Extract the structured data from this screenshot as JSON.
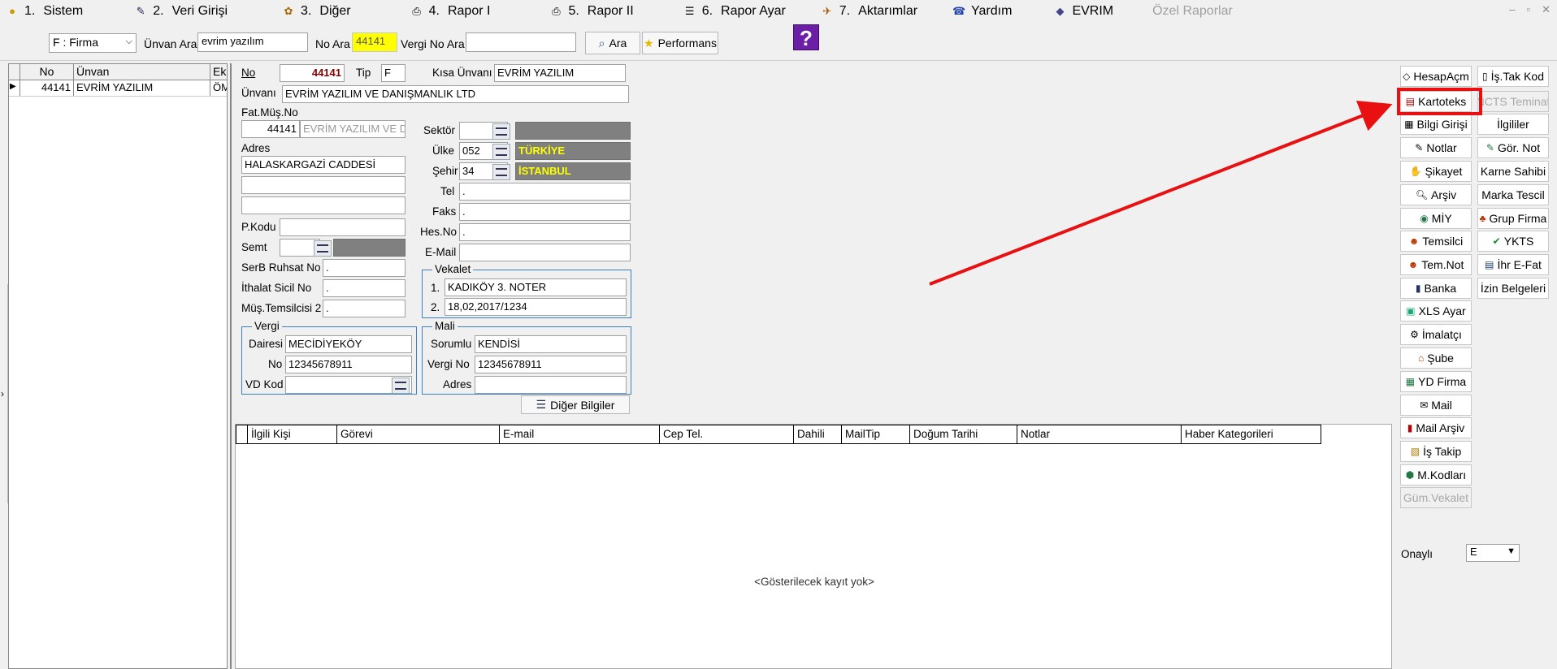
{
  "menu": [
    {
      "icon": "gold-coins-icon",
      "num": "1.",
      "label": "Sistem"
    },
    {
      "icon": "data-entry-icon",
      "num": "2.",
      "label": "Veri Girişi"
    },
    {
      "icon": "other-icon",
      "num": "3.",
      "label": "Diğer"
    },
    {
      "icon": "printer-icon",
      "num": "4.",
      "label": "Rapor I"
    },
    {
      "icon": "printer-icon",
      "num": "5.",
      "label": "Rapor II"
    },
    {
      "icon": "report-settings-icon",
      "num": "6.",
      "label": "Rapor Ayar"
    },
    {
      "icon": "transfer-icon",
      "num": "7.",
      "label": "Aktarımlar"
    },
    {
      "icon": "help-icon",
      "num": "",
      "label": "Yardım"
    },
    {
      "icon": "evrim-icon",
      "num": "",
      "label": "EVRIM"
    },
    {
      "icon": "",
      "num": "",
      "label": "Özel Raporlar"
    }
  ],
  "window_controls": [
    "–",
    "▫",
    "✕"
  ],
  "search": {
    "type_value": "F : Firma",
    "unvan_label": "Ünvan Ara",
    "unvan_value": "evrim yazılım",
    "no_label": "No Ara",
    "no_value": "44141",
    "vergi_label": "Vergi No Ara",
    "vergi_value": "",
    "ara_button": "Ara",
    "performans_button": "Performans",
    "help_glyph": "?"
  },
  "left_grid": {
    "columns": [
      "No",
      "Ünvan",
      "Ek"
    ],
    "rows": [
      {
        "no": "44141",
        "unvan": "EVRİM YAZILIM",
        "ek": "ÖM"
      }
    ]
  },
  "form": {
    "no_label": "No",
    "no_value": "44141",
    "tip_label": "Tip",
    "tip_value": "F",
    "kisa_label": "Kısa Ünvanı",
    "kisa_value": "EVRİM YAZILIM",
    "unvan_label": "Ünvanı",
    "unvan_value": "EVRİM YAZILIM VE DANIŞMANLIK LTD",
    "fatmus_label": "Fat.Müş.No",
    "fatmus_no": "44141",
    "fatmus_name": "EVRİM YAZILIM VE D",
    "adres_label": "Adres",
    "adres1": "HALASKARGAZİ CADDESİ",
    "adres2": "",
    "adres3": "",
    "pkodu_label": "P.Kodu",
    "pkodu_value": "",
    "semt_label": "Semt",
    "semt_value": "",
    "serb_label": "SerB Ruhsat No",
    "serb_value": ".",
    "ithalat_label": "İthalat Sicil No",
    "ithalat_value": ".",
    "mustem_label": "Müş.Temsilcisi 2",
    "mustem_value": ".",
    "sektor_label": "Sektör",
    "sektor_value": "",
    "sektor_name": "",
    "ulke_label": "Ülke",
    "ulke_value": "052",
    "ulke_name": "TÜRKİYE",
    "sehir_label": "Şehir",
    "sehir_value": "34",
    "sehir_name": "İSTANBUL",
    "tel_label": "Tel",
    "tel_value": ".",
    "faks_label": "Faks",
    "faks_value": ".",
    "hesno_label": "Hes.No",
    "hesno_value": ".",
    "email_label": "E-Mail",
    "email_value": "",
    "vekalet_title": "Vekalet",
    "vekalet_1_num": "1.",
    "vekalet_1": "KADIKÖY 3. NOTER",
    "vekalet_2_num": "2.",
    "vekalet_2": "18,02,2017/1234",
    "vergi_title": "Vergi",
    "vergi_dairesi_label": "Dairesi",
    "vergi_dairesi": "MECİDİYEKÖY",
    "vergi_no_label": "No",
    "vergi_no": "12345678911",
    "vd_kod_label": "VD Kod",
    "vd_kod": "",
    "mali_title": "Mali",
    "mali_sorumlu_label": "Sorumlu",
    "mali_sorumlu": "KENDİSİ",
    "mali_vergino_label": "Vergi No",
    "mali_vergino": "12345678911",
    "mali_adres_label": "Adres",
    "mali_adres": "",
    "diger_button": "Diğer Bilgiler"
  },
  "contacts": {
    "columns": [
      "İlgili Kişi",
      "Görevi",
      "E-mail",
      "Cep Tel.",
      "Dahili",
      "MailTip",
      "Doğum Tarihi",
      "Notlar",
      "Haber Kategorileri"
    ],
    "empty_text": "<Gösterilecek kayıt yok>"
  },
  "right_buttons": {
    "left": [
      "HesapAçm",
      "Kartoteks",
      "Bilgi Girişi",
      "Notlar",
      "Şikayet",
      "Arşiv",
      "MİY",
      "Temsilci",
      "Tem.Not",
      "Banka",
      "XLS Ayar",
      "İmalatçı",
      "Şube",
      "YD Firma",
      "Mail",
      "Mail Arşiv",
      "İş Takip",
      "M.Kodları",
      "Güm.Vekalet"
    ],
    "right": [
      "İş.Tak Kod",
      "NCTS Teminat",
      "İlgililer",
      "Gör. Not",
      "Karne Sahibi",
      "Marka Tescil",
      "Grup Firma",
      "YKTS",
      "İhr E-Fat",
      "İzin Belgeleri"
    ],
    "onayli_label": "Onaylı",
    "onayli_value": "E"
  },
  "colors": {
    "highlight": "#e81010",
    "group_border": "#3c7fc0",
    "lookup_name_text": "#ffff00",
    "help_purple": "#6b1fa6"
  }
}
